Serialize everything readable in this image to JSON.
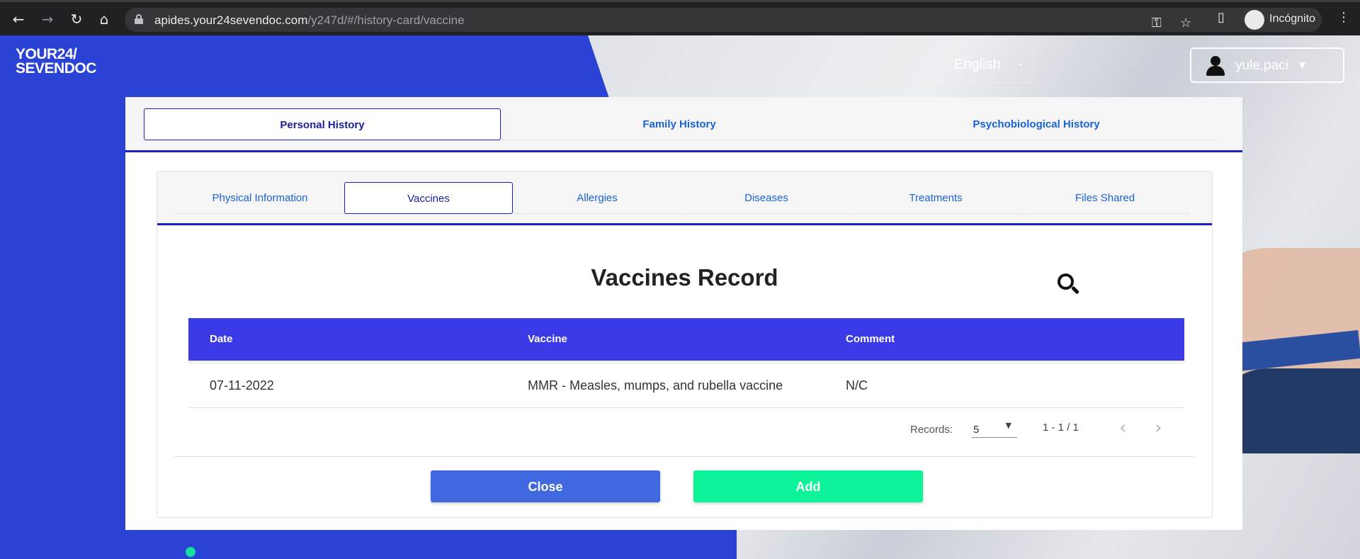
{
  "browser": {
    "url_host": "apides.your24sevendoc.com",
    "url_path": "/y247d/#/history-card/vaccine",
    "profile_label": "Incógnito",
    "icons": [
      "back-arrow-icon",
      "forward-arrow-icon",
      "reload-icon",
      "home-icon",
      "lock-icon",
      "key-icon",
      "star-icon",
      "sidebar-icon",
      "incognito-icon",
      "kebab-menu-icon"
    ]
  },
  "header": {
    "logo_line1": "YOUR24/",
    "logo_line2": "SEVENDOC",
    "language": "English",
    "username": "yule.paci"
  },
  "history_tabs": [
    {
      "label": "Personal History",
      "active": true
    },
    {
      "label": "Family History",
      "active": false
    },
    {
      "label": "Psychobiological History",
      "active": false
    }
  ],
  "personal_tabs": [
    {
      "label": "Physical Information",
      "active": false
    },
    {
      "label": "Vaccines",
      "active": true
    },
    {
      "label": "Allergies",
      "active": false
    },
    {
      "label": "Diseases",
      "active": false
    },
    {
      "label": "Treatments",
      "active": false
    },
    {
      "label": "Files Shared",
      "active": false
    }
  ],
  "record": {
    "title": "Vaccines Record",
    "columns": [
      "Date",
      "Vaccine",
      "Comment"
    ],
    "rows": [
      {
        "date": "07-11-2022",
        "vaccine": "MMR - Measles, mumps, and rubella vaccine",
        "comment": "N/C"
      }
    ]
  },
  "pagination": {
    "records_label": "Records:",
    "page_size": "5",
    "range": "1 - 1 / 1"
  },
  "actions": {
    "close": "Close",
    "add": "Add"
  },
  "colors": {
    "brand_blue": "#2a43d4",
    "tab_accent": "#1a1fc0",
    "table_header": "#3a3ae6",
    "close_button": "#4068e0",
    "add_button": "#0cf39a"
  }
}
